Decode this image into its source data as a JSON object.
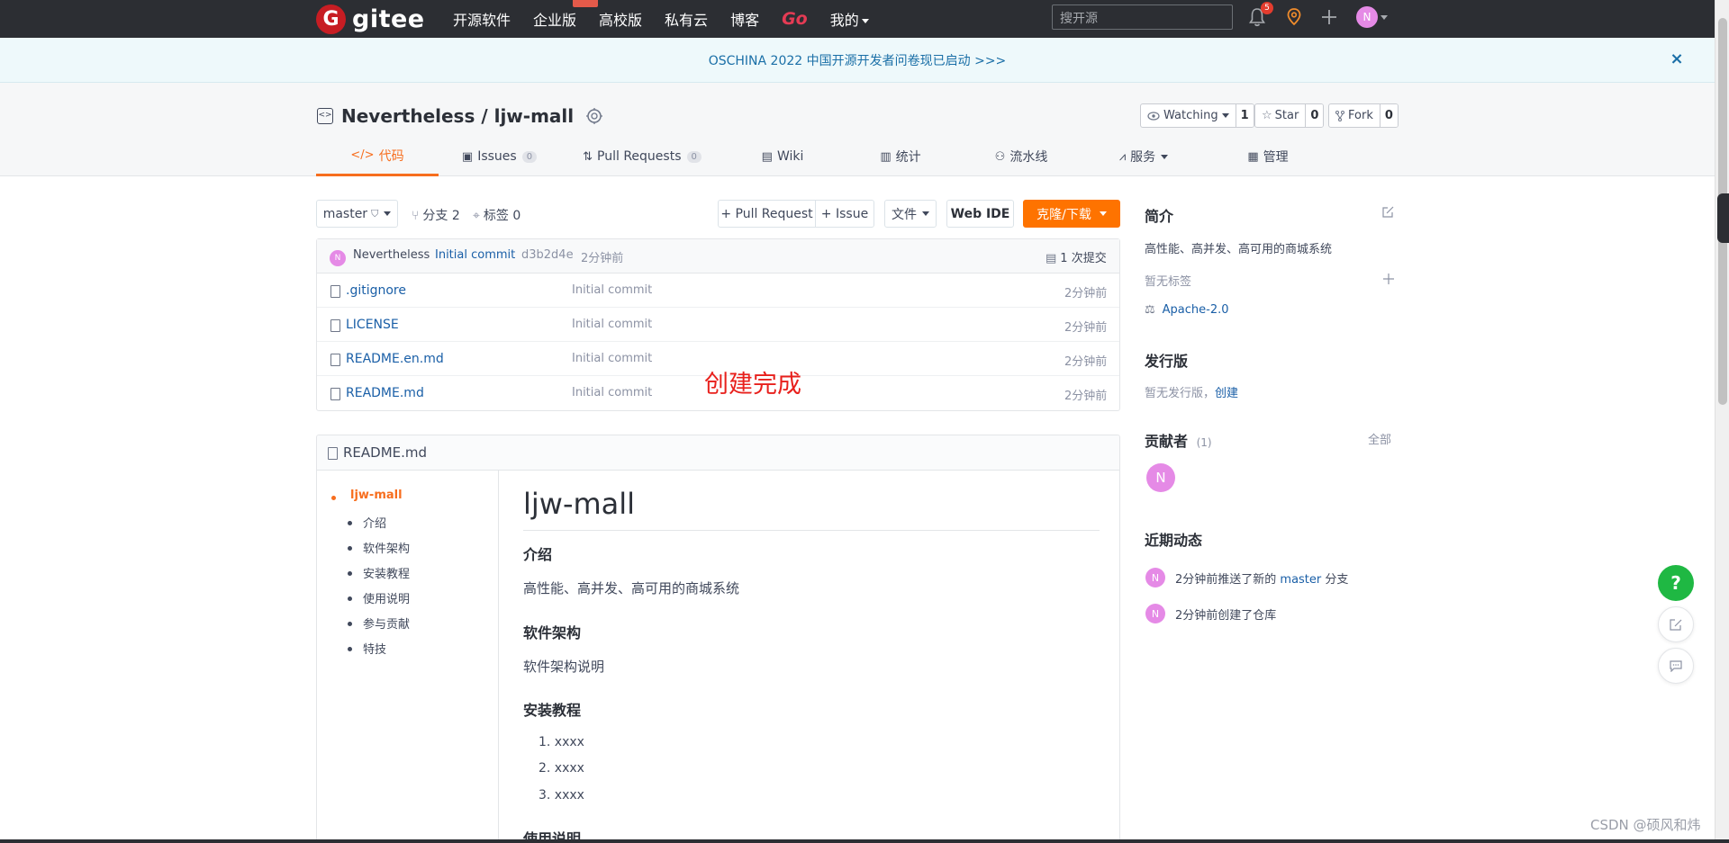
{
  "nav": {
    "logo_text": "gitee",
    "logo_letter": "G",
    "links": [
      "开源软件",
      "企业版",
      "高校版",
      "私有云",
      "博客",
      "Go",
      "我的"
    ],
    "search_placeholder": "搜开源",
    "notification_count": "5",
    "avatar_letter": "N"
  },
  "announcement": {
    "text": "OSCHINA 2022 中国开源开发者问卷现已启动 >>>",
    "close": "×"
  },
  "repo": {
    "owner": "Nevertheless",
    "separator": " / ",
    "name": "ljw-mall",
    "watching_label": "Watching",
    "watching_count": "1",
    "star_label": "Star",
    "star_count": "0",
    "fork_label": "Fork",
    "fork_count": "0"
  },
  "tabs": [
    {
      "label": "代码",
      "active": true
    },
    {
      "label": "Issues",
      "count": "0"
    },
    {
      "label": "Pull Requests",
      "count": "0"
    },
    {
      "label": "Wiki"
    },
    {
      "label": "统计"
    },
    {
      "label": "流水线"
    },
    {
      "label": "服务"
    },
    {
      "label": "管理"
    }
  ],
  "toolbar": {
    "branch": "master",
    "branches": "分支 2",
    "tags": "标签 0",
    "pull_request": "+ Pull Request",
    "issue": "+ Issue",
    "files": "文件",
    "web_ide": "Web IDE",
    "clone": "克隆/下载"
  },
  "commit": {
    "avatar_letter": "N",
    "author": "Nevertheless",
    "message": "Initial commit",
    "hash": "d3b2d4e",
    "time": "2分钟前",
    "count": "1 次提交"
  },
  "files": [
    {
      "name": ".gitignore",
      "message": "Initial commit",
      "time": "2分钟前"
    },
    {
      "name": "LICENSE",
      "message": "Initial commit",
      "time": "2分钟前"
    },
    {
      "name": "README.en.md",
      "message": "Initial commit",
      "time": "2分钟前"
    },
    {
      "name": "README.md",
      "message": "Initial commit",
      "time": "2分钟前"
    }
  ],
  "annotation": "创建完成",
  "readme": {
    "title": "README.md",
    "toc": [
      "ljw-mall",
      "介绍",
      "软件架构",
      "安装教程",
      "使用说明",
      "参与贡献",
      "特技"
    ],
    "h1": "ljw-mall",
    "intro_h": "介绍",
    "intro_p": "高性能、高并发、高可用的商城系统",
    "arch_h": "软件架构",
    "arch_p": "软件架构说明",
    "install_h": "安装教程",
    "install_items": [
      "1.  xxxx",
      "2.  xxxx",
      "3.  xxxx"
    ],
    "usage_h": "使用说明"
  },
  "sidebar": {
    "intro_title": "简介",
    "description": "高性能、高并发、高可用的商城系统",
    "no_tags": "暂无标签",
    "license": "Apache-2.0",
    "release_title": "发行版",
    "no_release": "暂无发行版，",
    "create": "创建",
    "contributors_title": "贡献者",
    "contributors_count": "(1)",
    "all": "全部",
    "contributor_letter": "N",
    "activity_title": "近期动态",
    "activity": [
      {
        "letter": "N",
        "prefix": "2分钟前推送了新的 ",
        "branch": "master",
        "suffix": " 分支"
      },
      {
        "letter": "N",
        "text": "2分钟前创建了仓库"
      }
    ]
  },
  "help": "?",
  "watermark": "CSDN @硕风和炜"
}
